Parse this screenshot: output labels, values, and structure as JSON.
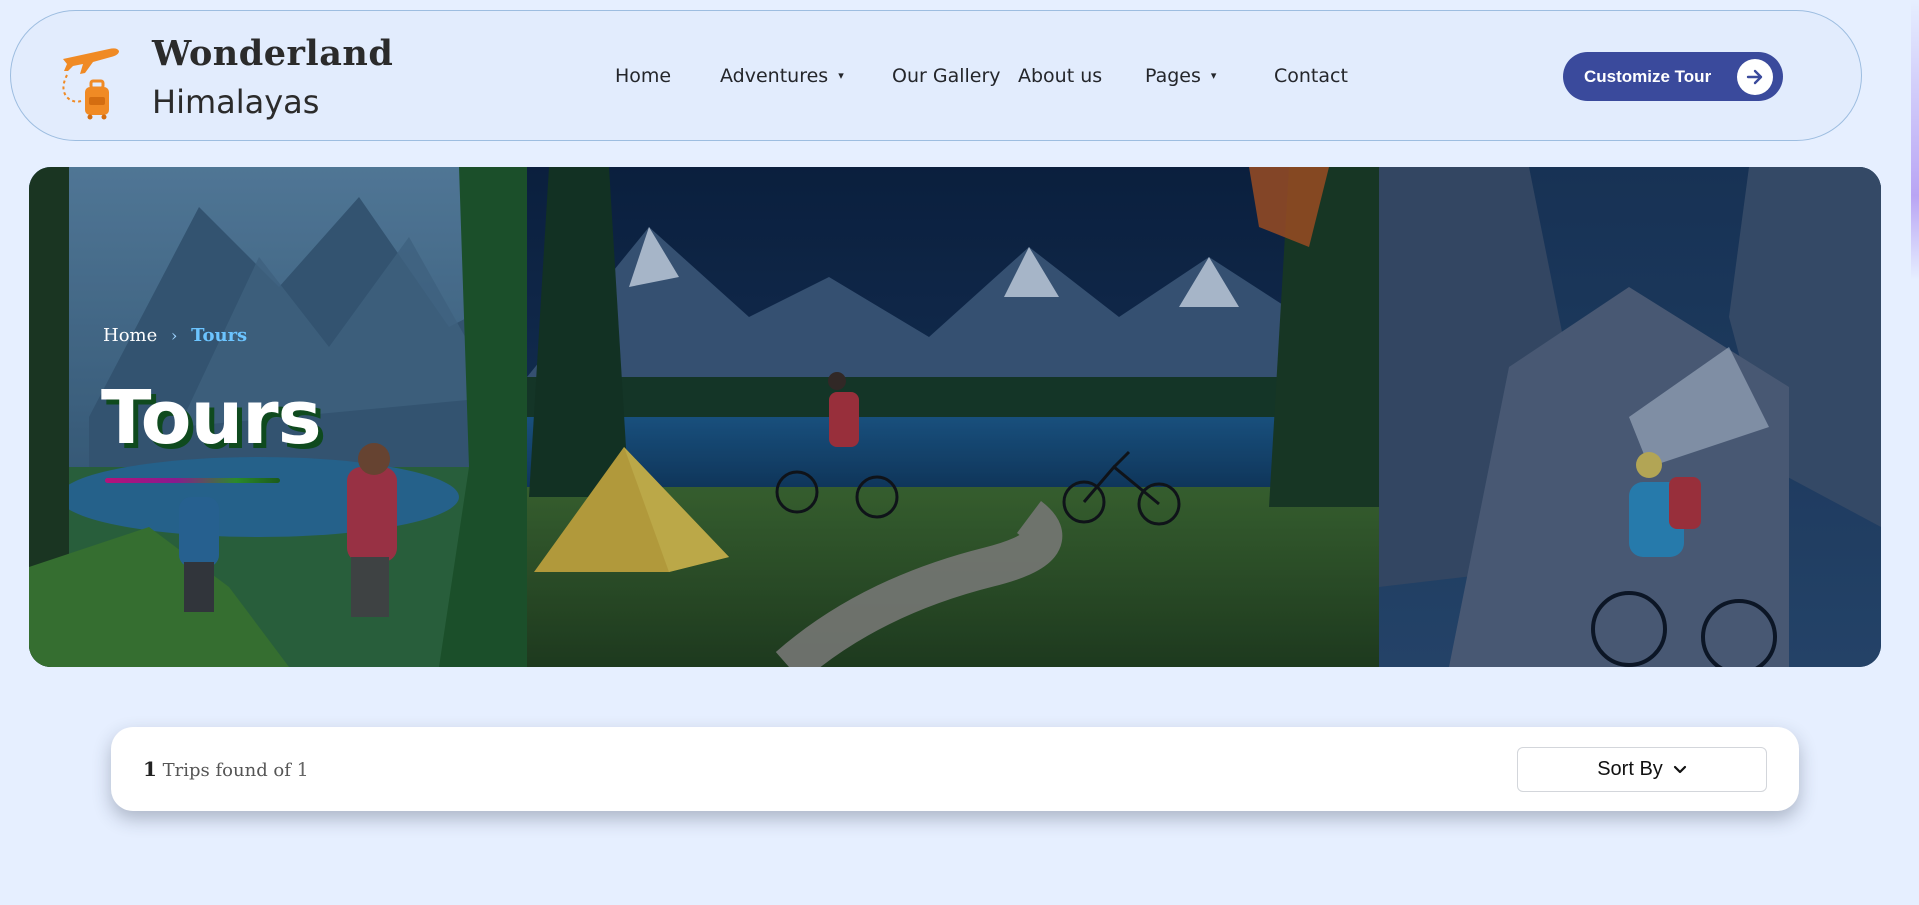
{
  "brand": {
    "line1": "Wonderland",
    "line2": "Himalayas",
    "accent_color": "#f08a24"
  },
  "nav": {
    "items": [
      {
        "label": "Home",
        "has_dropdown": false
      },
      {
        "label": "Adventures",
        "has_dropdown": true
      },
      {
        "label": "Our Gallery",
        "has_dropdown": false
      },
      {
        "label": "About us",
        "has_dropdown": false
      },
      {
        "label": "Pages",
        "has_dropdown": true
      },
      {
        "label": "Contact",
        "has_dropdown": false
      }
    ],
    "cta_label": "Customize Tour",
    "cta_color": "#3a4a9c",
    "cta_icon": "arrow-right-icon"
  },
  "hero": {
    "breadcrumb": {
      "home": "Home",
      "separator": "›",
      "current": "Tours"
    },
    "title": "Tours"
  },
  "results": {
    "count": "1",
    "text": "Trips found of",
    "total": "1",
    "sort_label": "Sort By",
    "sort_icon": "chevron-down-icon"
  }
}
